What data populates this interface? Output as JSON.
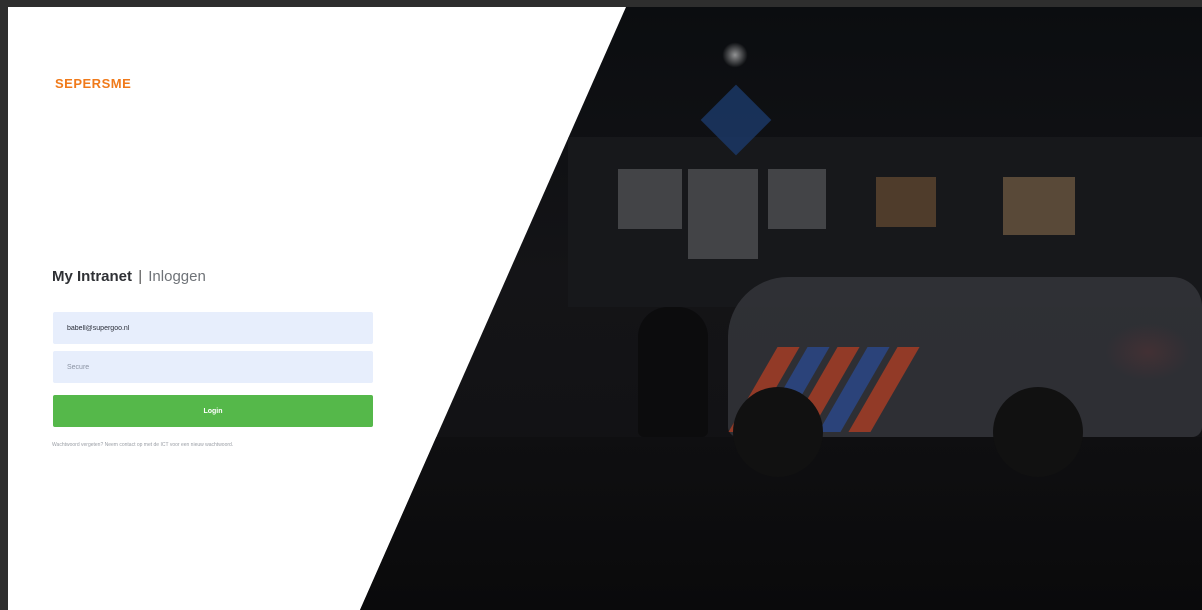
{
  "brand": {
    "logo_text": "SEPERSME",
    "colors": {
      "primary": "#f07a1a",
      "accent": "#e8321e"
    }
  },
  "login": {
    "title_strong": "My Intranet",
    "title_separator": "|",
    "title_light": "Inloggen",
    "email_value": "babell@supergoo.nl",
    "password_placeholder": "Secure",
    "button_label": "Login",
    "help_text": "Wachtwoord vergeten? Neem contact op met de ICT voor een nieuw wachtwoord.",
    "button_color": "#55b84a",
    "field_color": "#e7eefc"
  },
  "background": {
    "description_icon": "police-station-night-photo"
  }
}
